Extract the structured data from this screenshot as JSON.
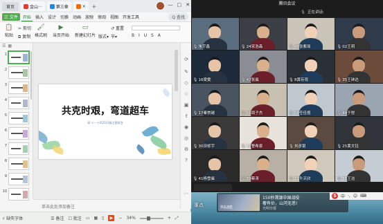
{
  "wps": {
    "titlebar": {
      "home_label": "首页",
      "tabs": [
        {
          "label": "金山···",
          "color": "#e53935"
        },
        {
          "label": "第三章",
          "color": "#1e88e5"
        }
      ],
      "add_label": "+"
    },
    "ribbon_tabs": [
      "三 文件",
      "开始",
      "插入",
      "设计",
      "切换",
      "动画",
      "放映",
      "审阅",
      "视图",
      "开发工具"
    ],
    "ribbon_active": "开始",
    "search_label": "Q 查找",
    "toolbar": {
      "paste": "粘贴",
      "cut": "剪切",
      "copy": "复制",
      "format_painter": "格式刷",
      "current_start": "当页开始",
      "new_slide": "新建幻灯片",
      "layout": "版式",
      "section": "节",
      "reset": "重置"
    },
    "slides": [
      {
        "num": "1"
      },
      {
        "num": "2"
      },
      {
        "num": "3"
      },
      {
        "num": "4"
      },
      {
        "num": "5"
      },
      {
        "num": "6"
      },
      {
        "num": "7"
      },
      {
        "num": "8"
      },
      {
        "num": "9"
      },
      {
        "num": "10"
      }
    ],
    "selected_slide": 1,
    "slide": {
      "title": "共克时艰，弯道超车",
      "subtitle": "高  十一十四2022级主题班会"
    },
    "notes_placeholder": "单击此处添加备注",
    "status": {
      "font": "缺失字体",
      "notes": "备注",
      "comments": "批注",
      "zoom": "34%"
    }
  },
  "meeting": {
    "title": "腾讯会议",
    "speaking_label": "正在讲话:",
    "participants": [
      {
        "name": "朱宇鑫"
      },
      {
        "name": "24宋浩森"
      },
      {
        "name": "48张紫琰"
      },
      {
        "name": "02王玥"
      },
      {
        "name": "16梁雯"
      },
      {
        "name": "47张晨"
      },
      {
        "name": "8黄存雨"
      },
      {
        "name": "35王钟达"
      },
      {
        "name": "17秦崇越"
      },
      {
        "name": "56周子杰"
      },
      {
        "name": "58任佳煜"
      },
      {
        "name": "44于悦"
      },
      {
        "name": "30田祯宇"
      },
      {
        "name": "12曹希豪"
      },
      {
        "name": "刘彦锟"
      },
      {
        "name": "25黄文钰"
      },
      {
        "name": "41杨雪晨"
      },
      {
        "name": "39蔡涛"
      },
      {
        "name": "21牛天欣"
      },
      {
        "name": "36王洁"
      }
    ]
  },
  "desktop": {
    "left_text": "事点",
    "news": {
      "image_caption": "突击战区",
      "headline1": "150秒溯源中国战役",
      "headline2": "奢有价，山河无恙!",
      "source": "光明日报"
    },
    "sogou": [
      "S",
      "中",
      "·,",
      "☺",
      "⌨"
    ]
  }
}
